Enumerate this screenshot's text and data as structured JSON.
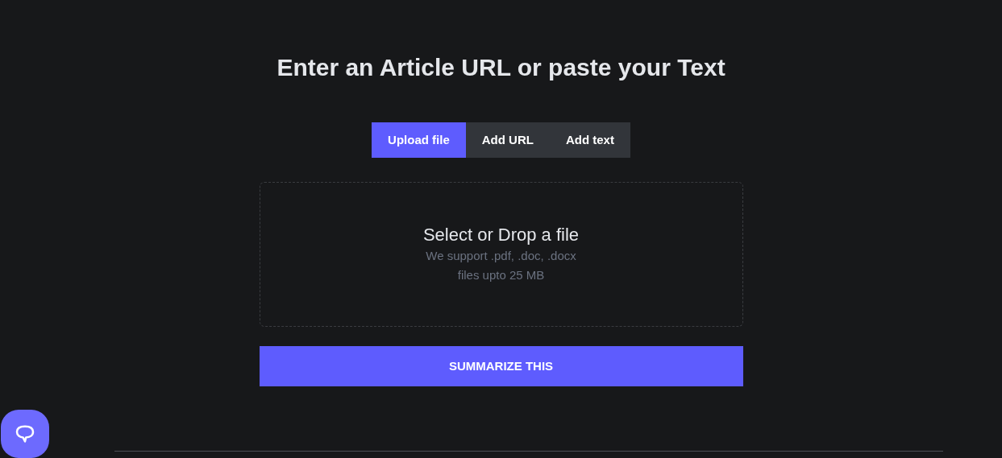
{
  "heading": "Enter an Article URL or paste your Text",
  "tabs": [
    {
      "label": "Upload file",
      "selected": true
    },
    {
      "label": "Add URL",
      "selected": false
    },
    {
      "label": "Add text",
      "selected": false
    }
  ],
  "dropzone": {
    "title": "Select or Drop a file",
    "lines": [
      "We support .pdf, .doc, .docx",
      "files upto 25 MB"
    ]
  },
  "submit_button": "SUMMARIZE THIS"
}
